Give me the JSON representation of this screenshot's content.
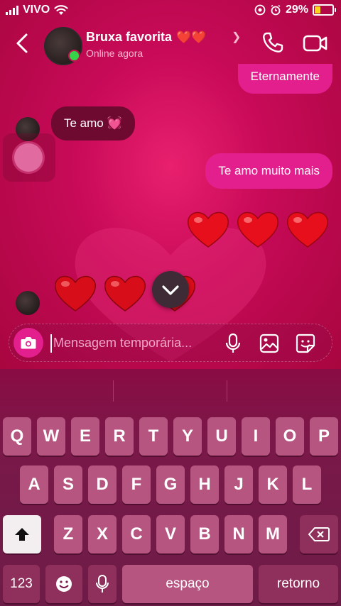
{
  "status_bar": {
    "carrier": "VIVO",
    "battery_percent": "29%",
    "battery_level": 0.29,
    "battery_color": "#ffd21f"
  },
  "header": {
    "contact_name": "Bruxa favorita",
    "name_emoji": "❤️❤️",
    "status": "Online agora",
    "icons": [
      "back-arrow-icon",
      "chevron-right-icon",
      "phone-icon",
      "video-camera-icon"
    ]
  },
  "messages": [
    {
      "side": "sent",
      "text": "Eternamente"
    },
    {
      "side": "received",
      "text": "Te amo 💓"
    },
    {
      "side": "sent",
      "text": "Te amo muito mais"
    },
    {
      "side": "sent",
      "text": "❤️❤️❤️"
    },
    {
      "side": "received",
      "text": "❤️❤️❤️"
    }
  ],
  "composer": {
    "placeholder": "Mensagem temporária...",
    "icons": [
      "camera-icon",
      "microphone-icon",
      "image-icon",
      "sticker-icon"
    ]
  },
  "keyboard": {
    "row1": [
      "Q",
      "W",
      "E",
      "R",
      "T",
      "Y",
      "U",
      "I",
      "O",
      "P"
    ],
    "row2": [
      "A",
      "S",
      "D",
      "F",
      "G",
      "H",
      "J",
      "K",
      "L"
    ],
    "row3": [
      "Z",
      "X",
      "C",
      "V",
      "B",
      "N",
      "M"
    ],
    "numbers_key": "123",
    "space_key": "espaço",
    "return_key": "retorno"
  },
  "colors": {
    "accent": "#e21f8c",
    "background": "#c10850",
    "online": "#34d34a"
  }
}
